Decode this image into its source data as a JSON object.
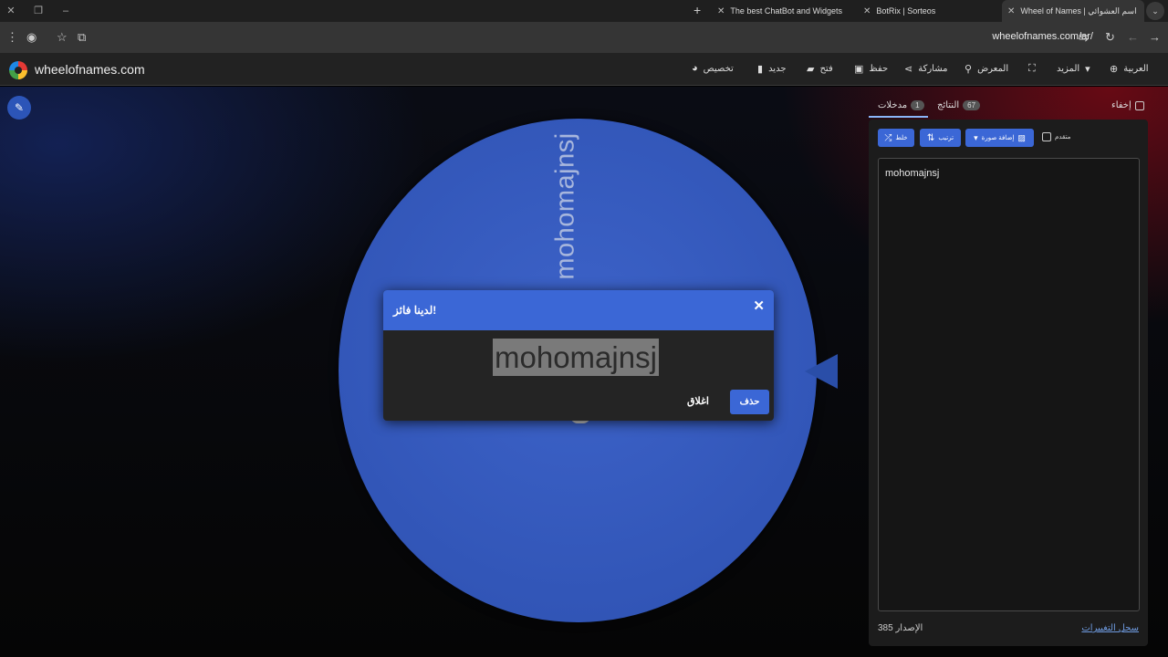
{
  "browser": {
    "tabs": [
      {
        "title": "The best ChatBot and Widgets"
      },
      {
        "title": "BotRix | Sorteos"
      },
      {
        "title": "Wheel of Names | اسم العشوائي"
      }
    ],
    "new_tab": "+",
    "url": "wheelofnames.com/ar/"
  },
  "site": {
    "name": "wheelofnames.com",
    "nav": {
      "language": "العربية",
      "more": "المزيد",
      "gallery": "المعرض",
      "share": "مشاركة",
      "save": "حفظ",
      "open": "فتح",
      "new": "جديد",
      "customize": "تخصيص"
    }
  },
  "wheel": {
    "segment_label": "mohomajnsj"
  },
  "dialog": {
    "title": "لدينا فائز!",
    "winner": "mohomajnsj",
    "close_label": "اغلاق",
    "remove_label": "حذف"
  },
  "panel": {
    "hide_label": "إخفاء",
    "results_label": "النتائج",
    "results_count": "67",
    "entries_label": "مدخلات",
    "entries_count": "1",
    "shuffle_label": "خلط",
    "sort_label": "ترتيب",
    "add_image_label": "إضافة صورة",
    "advanced_label": "متقدم",
    "entries": [
      "mohomajnsj"
    ],
    "version_label": "الإصدار",
    "version_number": "385",
    "changelog_label": "سجل التغييرات"
  },
  "colors": {
    "accent": "#3b67d6",
    "wheel": "#3358b8",
    "link": "#6f9be0"
  }
}
